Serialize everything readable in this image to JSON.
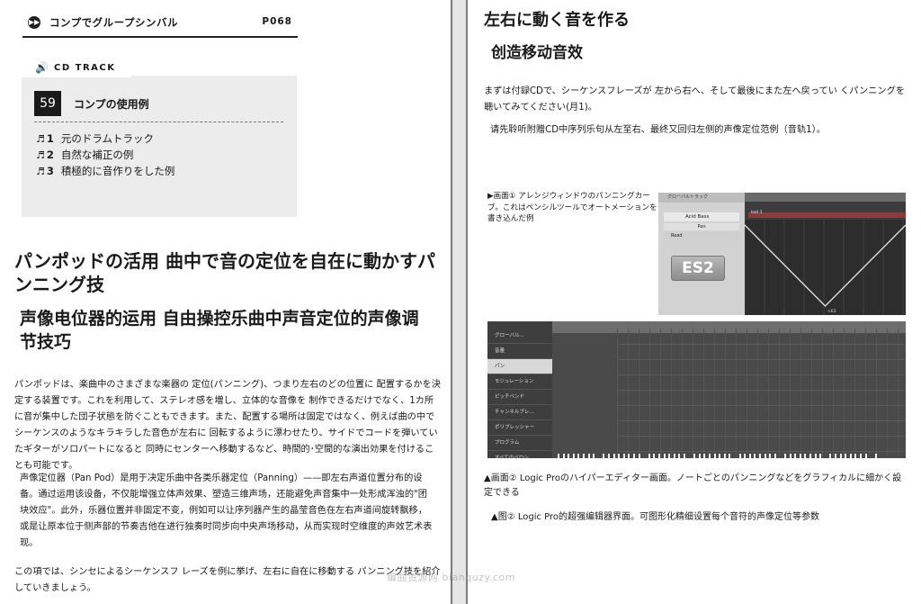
{
  "left_page": {
    "header": {
      "title": "コンプでグループシンバル",
      "page_number": "P068"
    },
    "cd_track": {
      "label": "CD TRACK",
      "number": "59",
      "title": "コンプの使用例",
      "items": [
        {
          "num": "1",
          "text": "元のドラムトラック"
        },
        {
          "num": "2",
          "text": "自然な補正の例"
        },
        {
          "num": "3",
          "text": "積極的に音作りをした例"
        }
      ]
    },
    "heading_jp": "パンポッドの活用 曲中で音の定位を自在に動かすパンニング技",
    "heading_cn": "声像电位器的运用 自由操控乐曲中声音定位的声像调节技巧",
    "para_jp": "パンポッドは、楽曲中のさまざまな楽器の 定位(パンニング)、つまり左右のどの位置に 配置するかを決定する装置です。これを利用して、ステレオ感を増し、立体的な音像を 制作できるだけでなく、1カ所に音が集中した団子状態を防ぐこともできます。また、配置する場所は固定ではなく、例えば曲の中で シーケンスのようなキラキラした音色が左右に 回転するように漂わせたり、サイドでコードを弾いていたギターがソロパートになると 同時にセンターへ移動するなど、時間的･空間的な演出効果を付けることも可能です。",
    "para_cn": "声像定位器（Pan Pod）是用于决定乐曲中各类乐器定位（Panning）——即左右声道位置分布的设备。通过运用该设备，不仅能增强立体声效果、塑造三维声场，还能避免声音集中一处形成浑浊的\"团块效应\"。此外，乐器位置并非固定不变，例如可以让序列器产生的晶莹音色在左右声道间旋转飘移，或是让原本位于侧声部的节奏吉他在进行独奏时同步向中央声场移动，从而实现时空维度的声效艺术表现。",
    "para_jp2": "この項では、シンセによるシーケンスフ レーズを例に挙げ、左右に自在に移動する パンニング技を紹介していきましょう。"
  },
  "right_page": {
    "title_jp": "左右に動く音を作る",
    "title_cn": "创造移动音效",
    "para_jp": "まずは付録CDで、シーケンスフレーズが 左から右へ、そして最後にまた左へ戻ってい くパンニングを聴いてみてください(月1)。",
    "para_cn": "请先聆听附赠CD中序列乐句从左至右、最终又回归左侧的声像定位范例（音轨1）。",
    "caption1": "▶画面① アレンジウィンドウのパンニングカーブ。これはペンシルツールでオートメーションを書き込んだ例",
    "screenshot1": {
      "panel_header": "グローバルトラック",
      "track_name": "Acid Bass",
      "pan_label": "Pan",
      "read_label": "Read",
      "logo": "ES2",
      "region_label": "Inst 1",
      "automation": [
        0,
        1,
        0
      ],
      "curve_label": "+63"
    },
    "screenshot2": {
      "lanes": [
        "グローバル...",
        "音量",
        "パン",
        "モジュレーション",
        "ピッチベンド",
        "チャンネルプレ...",
        "ポリプレッシャー",
        "プログラム",
        "すべてのベロシ..."
      ],
      "selected_lane": 2
    },
    "caption2_jp": "▲画面② Logic Proのハイパーエディター画面。ノートごとのパンニングなどをグラフィカルに細かく設定できる",
    "caption2_cn": "▲图② Logic Pro的超强编辑器界面。可图形化精细设置每个音符的声像定位等参数"
  },
  "watermark": "编曲资源网 bianquzy.com"
}
